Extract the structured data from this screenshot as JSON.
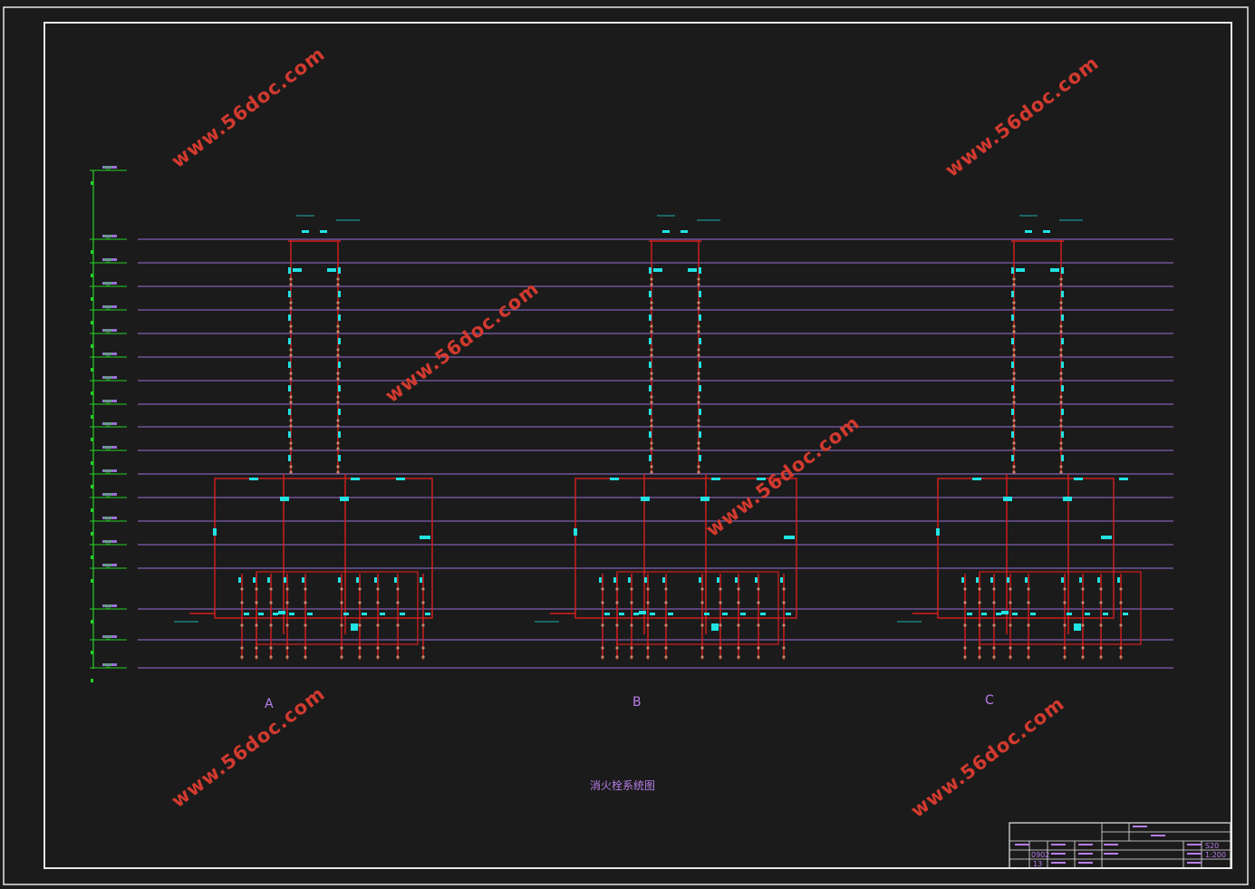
{
  "drawing": {
    "title": "消火栓系统图",
    "sections": [
      "A",
      "B",
      "C"
    ],
    "watermark": "www.56doc.com",
    "floors": 17,
    "colors": {
      "background": "#1b1b1b",
      "frame": "#e8e8e8",
      "floor_line": "#9a6fd6",
      "pipe": "#d81e1e",
      "fixture": "#21e3e3",
      "valve": "#c08a6a",
      "elevation": "#26d026",
      "text": "#b87ee8",
      "watermark": "#d23a2f"
    }
  },
  "title_block": {
    "scale": "1:200",
    "sheet": "S20",
    "code": "0902",
    "number": "13"
  }
}
